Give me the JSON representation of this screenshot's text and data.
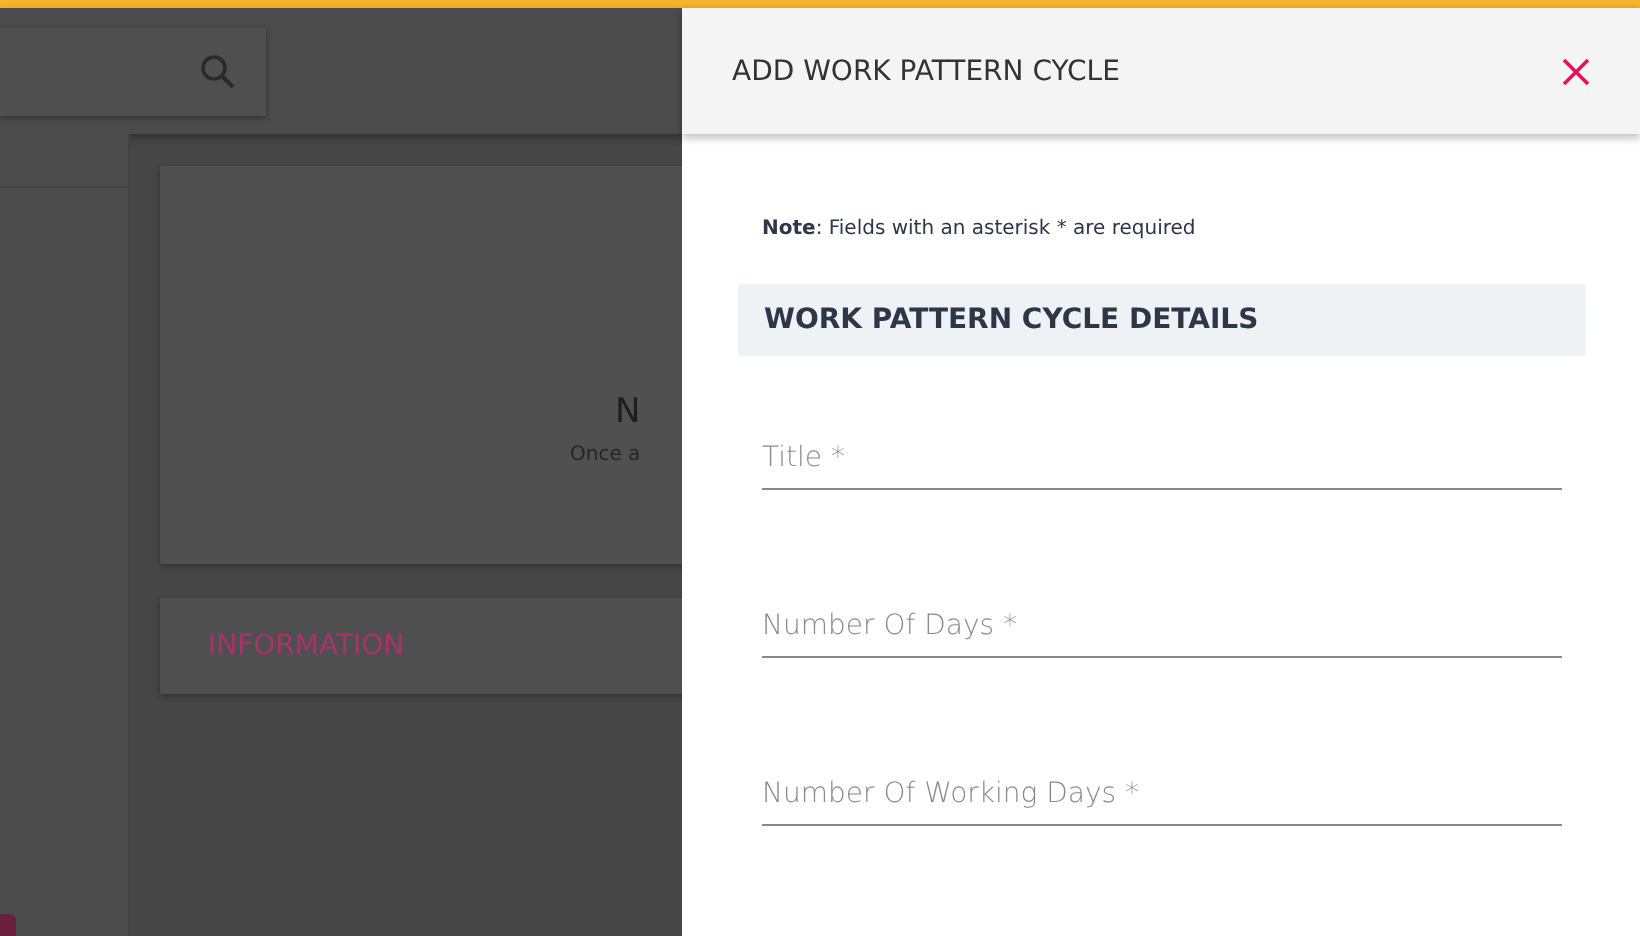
{
  "background": {
    "card": {
      "heading": "N",
      "text": "Once a"
    },
    "info_card": {
      "title": "INFORMATION"
    }
  },
  "panel": {
    "title": "ADD WORK PATTERN CYCLE",
    "note": "**Note**: Fields with an asterisk * are required",
    "section": "WORK PATTERN CYCLE DETAILS",
    "fields": [
      {
        "placeholder": "Title *"
      },
      {
        "placeholder": "Number Of Days *"
      },
      {
        "placeholder": "Number Of Working Days *"
      }
    ]
  }
}
